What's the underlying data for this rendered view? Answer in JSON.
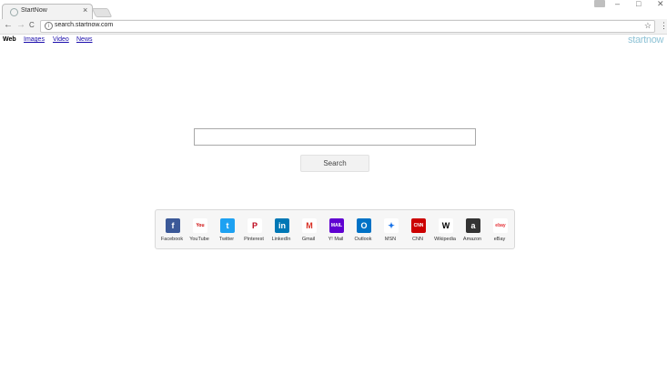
{
  "browser": {
    "tab_title": "StartNow",
    "tab_close": "×",
    "url": "search.startnow.com",
    "window": {
      "minimize": "–",
      "maximize": "□",
      "close": "✕"
    },
    "nav": {
      "back": "←",
      "forward": "→",
      "reload": "C"
    },
    "star": "☆",
    "menu": "⋮"
  },
  "links": {
    "items": [
      "Web",
      "Images",
      "Video",
      "News"
    ],
    "brand": "startnow"
  },
  "search": {
    "placeholder": "",
    "button_label": "Search"
  },
  "quick_links": [
    {
      "label": "Facebook",
      "glyph": "f",
      "color": "#3b5998",
      "icon": "facebook-icon"
    },
    {
      "label": "YouTube",
      "glyph": "You",
      "color": "#ffffff",
      "icon": "youtube-icon"
    },
    {
      "label": "Twitter",
      "glyph": "t",
      "color": "#1da1f2",
      "icon": "twitter-icon"
    },
    {
      "label": "Pinterest",
      "glyph": "P",
      "color": "#ffffff",
      "icon": "pinterest-icon"
    },
    {
      "label": "LinkedIn",
      "glyph": "in",
      "color": "#0077b5",
      "icon": "linkedin-icon"
    },
    {
      "label": "Gmail",
      "glyph": "M",
      "color": "#ffffff",
      "icon": "gmail-icon"
    },
    {
      "label": "Y! Mail",
      "glyph": "MAIL",
      "color": "#5f01d1",
      "icon": "yahoo-mail-icon"
    },
    {
      "label": "Outlook",
      "glyph": "O",
      "color": "#0072c6",
      "icon": "outlook-icon"
    },
    {
      "label": "MSN",
      "glyph": "✦",
      "color": "#ffffff",
      "icon": "msn-icon"
    },
    {
      "label": "CNN",
      "glyph": "CNN",
      "color": "#cc0000",
      "icon": "cnn-icon"
    },
    {
      "label": "Wikipedia",
      "glyph": "W",
      "color": "#ffffff",
      "icon": "wikipedia-icon"
    },
    {
      "label": "Amazon",
      "glyph": "a",
      "color": "#333333",
      "icon": "amazon-icon"
    },
    {
      "label": "eBay",
      "glyph": "ebay",
      "color": "#ffffff",
      "icon": "ebay-icon"
    }
  ]
}
